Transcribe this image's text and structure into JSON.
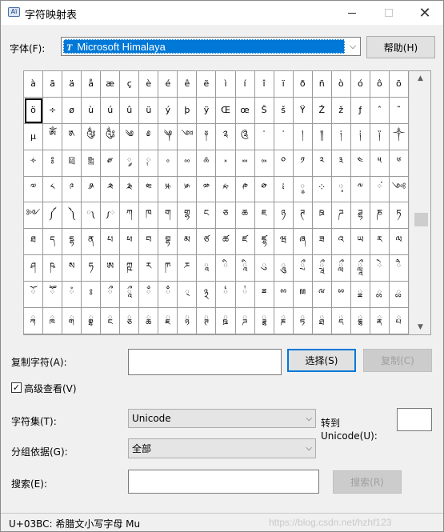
{
  "window": {
    "title": "字符映射表",
    "app_icon_glyph": "Aï",
    "min_icon": "minimize-icon",
    "max_icon": "maximize-icon",
    "close_icon": "close-icon",
    "close_glyph": "✕"
  },
  "font": {
    "label": "字体(F):",
    "selected": "Microsoft Himalaya",
    "type_icon": "T",
    "help_label": "帮助(H)"
  },
  "grid": {
    "selected_index": 20,
    "chars": [
      "à",
      "ã",
      "ä",
      "å",
      "æ",
      "ç",
      "è",
      "é",
      "ê",
      "ë",
      "ì",
      "í",
      "î",
      "ï",
      "ð",
      "ñ",
      "ò",
      "ó",
      "ô",
      "õ",
      "ö",
      "÷",
      "ø",
      "ù",
      "ú",
      "û",
      "ü",
      "ý",
      "þ",
      "ÿ",
      "Œ",
      "œ",
      "Š",
      "š",
      "Ÿ",
      "Ž",
      "ž",
      "ƒ",
      "ˆ",
      "˜",
      "µ",
      "ༀ",
      "༁",
      "༂",
      "༃",
      "༄",
      "༅",
      "༆",
      "༇",
      "༈",
      "༉",
      "༊",
      "་",
      "༌",
      "།",
      "༎",
      "༏",
      "༐",
      "༑",
      "༒",
      "༓",
      "༔",
      "༕",
      "༖",
      "༗",
      "༘",
      "༙",
      "༚",
      "༛",
      "༜",
      "༝",
      "༞",
      "༟",
      "༠",
      "༡",
      "༢",
      "༣",
      "༤",
      "༥",
      "༦",
      "༧",
      "༨",
      "༩",
      "༪",
      "༫",
      "༬",
      "༭",
      "༮",
      "༯",
      "༰",
      "༱",
      "༲",
      "༳",
      "༴",
      "༵",
      "༶",
      "༷",
      "༸",
      "༹",
      "༺",
      "༻",
      "༼",
      "༽",
      "༾",
      "༿",
      "ཀ",
      "ཁ",
      "ག",
      "གྷ",
      "ང",
      "ཅ",
      "ཆ",
      "ཇ",
      "ཉ",
      "ཊ",
      "ཋ",
      "ཌ",
      "ཌྷ",
      "ཎ",
      "ཏ",
      "ཐ",
      "ད",
      "དྷ",
      "ན",
      "པ",
      "ཕ",
      "བ",
      "བྷ",
      "མ",
      "ཙ",
      "ཚ",
      "ཛ",
      "ཛྷ",
      "ཝ",
      "ཞ",
      "ཟ",
      "འ",
      "ཡ",
      "ར",
      "ལ",
      "ཤ",
      "ཥ",
      "ས",
      "ཧ",
      "ཨ",
      "ཀྵ",
      "ཪ",
      "ཫ",
      "ཬ",
      "ཱ",
      "ི",
      "ཱི",
      "ུ",
      "ཱུ",
      "ྲྀ",
      "ཷ",
      "ླྀ",
      "ཹ",
      "ེ",
      "ཻ",
      "ོ",
      "ཽ",
      "ཾ",
      "ཿ",
      "ྀ",
      "ཱྀ",
      "ྂ",
      "ྃ",
      "྄",
      "྅",
      "྆",
      "྇",
      "ྈ",
      "ྉ",
      "ྊ",
      "ྋ",
      "ྌ",
      "ྍ",
      "ྎ",
      "ྏ",
      "ྐ",
      "ྑ",
      "ྒ",
      "ྒྷ",
      "ྔ",
      "ྕ",
      "ྖ",
      "ྗ",
      "ྙ",
      "ྚ",
      "ྛ",
      "ྜ",
      "ྜྷ",
      "ྞ",
      "ྟ",
      "ྠ",
      "ྡ",
      "ྡྷ",
      "ྣ",
      "ྤ"
    ]
  },
  "copy": {
    "label": "复制字符(A):",
    "value": "",
    "select_label": "选择(S)",
    "copy_label": "复制(C)"
  },
  "advanced": {
    "checked": true,
    "check_glyph": "✓",
    "label": "高级查看(V)"
  },
  "charset": {
    "label": "字符集(T):",
    "value": "Unicode"
  },
  "goto": {
    "label": "转到",
    "label2": "Unicode(U):",
    "value": ""
  },
  "group": {
    "label": "分组依据(G):",
    "value": "全部"
  },
  "search": {
    "label": "搜索(E):",
    "value": "",
    "button_label": "搜索(R)"
  },
  "status": {
    "text": "U+03BC: 希腊文小写字母 Mu",
    "watermark": "https://blog.csdn.net/hzhf123"
  }
}
